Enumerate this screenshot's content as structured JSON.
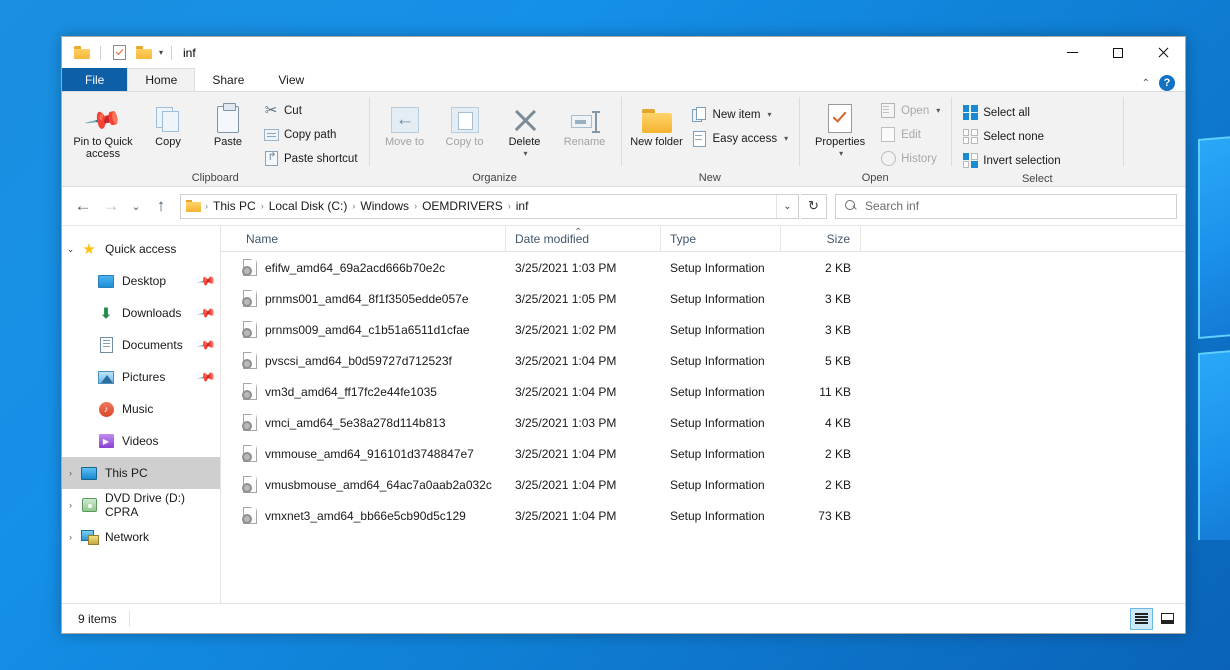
{
  "window": {
    "title": "inf",
    "controls": {
      "minimize": "—",
      "maximize": "□",
      "close": "✕"
    },
    "quick_access_toolbar": [
      {
        "name": "folder-icon",
        "label": "Folder"
      },
      {
        "name": "properties-icon",
        "label": "Properties"
      },
      {
        "name": "new-folder-icon",
        "label": "New folder"
      },
      {
        "name": "customize-caret-icon",
        "label": "▾"
      }
    ]
  },
  "ribbon": {
    "tabs": [
      {
        "label": "File",
        "active": false,
        "kind": "file"
      },
      {
        "label": "Home",
        "active": true,
        "kind": "normal"
      },
      {
        "label": "Share",
        "active": false,
        "kind": "normal"
      },
      {
        "label": "View",
        "active": false,
        "kind": "normal"
      }
    ],
    "collapse_arrow": "⌃",
    "help_label": "?",
    "groups": [
      {
        "label": "Clipboard",
        "big_buttons": [
          {
            "label": "Pin to Quick access",
            "icon": "pin-icon",
            "disabled": false
          },
          {
            "label": "Copy",
            "icon": "copy-icon",
            "disabled": false
          },
          {
            "label": "Paste",
            "icon": "paste-icon",
            "disabled": false
          }
        ],
        "small_buttons": [
          {
            "label": "Cut",
            "icon": "cut-icon",
            "disabled": false
          },
          {
            "label": "Copy path",
            "icon": "copy-path-icon",
            "disabled": false
          },
          {
            "label": "Paste shortcut",
            "icon": "paste-shortcut-icon",
            "disabled": false
          }
        ]
      },
      {
        "label": "Organize",
        "big_buttons": [
          {
            "label": "Move to",
            "icon": "move-to-icon",
            "disabled": true,
            "caret": "▾"
          },
          {
            "label": "Copy to",
            "icon": "copy-to-icon",
            "disabled": true,
            "caret": "▾"
          },
          {
            "label": "Delete",
            "icon": "delete-icon",
            "disabled": false,
            "caret": "▾"
          },
          {
            "label": "Rename",
            "icon": "rename-icon",
            "disabled": true
          }
        ],
        "small_buttons": []
      },
      {
        "label": "New",
        "big_buttons": [
          {
            "label": "New folder",
            "icon": "new-folder-icon",
            "disabled": false
          }
        ],
        "small_buttons": [
          {
            "label": "New item",
            "icon": "new-item-icon",
            "disabled": false,
            "caret": "▾"
          },
          {
            "label": "Easy access",
            "icon": "easy-access-icon",
            "disabled": false,
            "caret": "▾"
          }
        ]
      },
      {
        "label": "Open",
        "big_buttons": [
          {
            "label": "Properties",
            "icon": "properties-icon",
            "disabled": false,
            "caret": "▾"
          }
        ],
        "small_buttons": [
          {
            "label": "Open",
            "icon": "open-icon",
            "disabled": true,
            "caret": "▾"
          },
          {
            "label": "Edit",
            "icon": "edit-icon",
            "disabled": true
          },
          {
            "label": "History",
            "icon": "history-icon",
            "disabled": true
          }
        ]
      },
      {
        "label": "Select",
        "big_buttons": [],
        "small_buttons": [
          {
            "label": "Select all",
            "icon": "select-all-icon",
            "disabled": false
          },
          {
            "label": "Select none",
            "icon": "select-none-icon",
            "disabled": false
          },
          {
            "label": "Invert selection",
            "icon": "invert-selection-icon",
            "disabled": false
          }
        ]
      }
    ]
  },
  "navigation": {
    "back": "←",
    "forward": "→",
    "recent": "⌄",
    "up": "↑",
    "breadcrumbs": [
      "This PC",
      "Local Disk (C:)",
      "Windows",
      "OEMDRIVERS",
      "inf"
    ],
    "separator": "›",
    "dropdown": "⌄",
    "refresh": "↻"
  },
  "search": {
    "placeholder": "Search inf",
    "icon": "search-icon"
  },
  "sidebar": {
    "items": [
      {
        "label": "Quick access",
        "icon": "star-icon",
        "chevron": "⌄",
        "expanded": true,
        "level": 0,
        "pinned": false,
        "selected": false
      },
      {
        "label": "Desktop",
        "icon": "desktop-icon",
        "chevron": "",
        "level": 1,
        "pinned": true,
        "selected": false
      },
      {
        "label": "Downloads",
        "icon": "downloads-icon",
        "chevron": "",
        "level": 1,
        "pinned": true,
        "selected": false
      },
      {
        "label": "Documents",
        "icon": "documents-icon",
        "chevron": "",
        "level": 1,
        "pinned": true,
        "selected": false
      },
      {
        "label": "Pictures",
        "icon": "pictures-icon",
        "chevron": "",
        "level": 1,
        "pinned": true,
        "selected": false
      },
      {
        "label": "Music",
        "icon": "music-icon",
        "chevron": "",
        "level": 1,
        "pinned": false,
        "selected": false
      },
      {
        "label": "Videos",
        "icon": "videos-icon",
        "chevron": "",
        "level": 1,
        "pinned": false,
        "selected": false
      },
      {
        "label": "This PC",
        "icon": "this-pc-icon",
        "chevron": "›",
        "level": 0,
        "pinned": false,
        "selected": true
      },
      {
        "label": "DVD Drive (D:) CPRA",
        "icon": "dvd-drive-icon",
        "chevron": "›",
        "level": 0,
        "pinned": false,
        "selected": false
      },
      {
        "label": "Network",
        "icon": "network-icon",
        "chevron": "›",
        "level": 0,
        "pinned": false,
        "selected": false
      }
    ]
  },
  "filelist": {
    "columns": [
      "Name",
      "Date modified",
      "Type",
      "Size"
    ],
    "sort_column": "Name",
    "sort_indicator": "⌃",
    "rows": [
      {
        "name": "efifw_amd64_69a2acd666b70e2c",
        "date": "3/25/2021 1:03 PM",
        "type": "Setup Information",
        "size": "2 KB"
      },
      {
        "name": "prnms001_amd64_8f1f3505edde057e",
        "date": "3/25/2021 1:05 PM",
        "type": "Setup Information",
        "size": "3 KB"
      },
      {
        "name": "prnms009_amd64_c1b51a6511d1cfae",
        "date": "3/25/2021 1:02 PM",
        "type": "Setup Information",
        "size": "3 KB"
      },
      {
        "name": "pvscsi_amd64_b0d59727d712523f",
        "date": "3/25/2021 1:04 PM",
        "type": "Setup Information",
        "size": "5 KB"
      },
      {
        "name": "vm3d_amd64_ff17fc2e44fe1035",
        "date": "3/25/2021 1:04 PM",
        "type": "Setup Information",
        "size": "11 KB"
      },
      {
        "name": "vmci_amd64_5e38a278d114b813",
        "date": "3/25/2021 1:03 PM",
        "type": "Setup Information",
        "size": "4 KB"
      },
      {
        "name": "vmmouse_amd64_916101d3748847e7",
        "date": "3/25/2021 1:04 PM",
        "type": "Setup Information",
        "size": "2 KB"
      },
      {
        "name": "vmusbmouse_amd64_64ac7a0aab2a032c",
        "date": "3/25/2021 1:04 PM",
        "type": "Setup Information",
        "size": "2 KB"
      },
      {
        "name": "vmxnet3_amd64_bb66e5cb90d5c129",
        "date": "3/25/2021 1:04 PM",
        "type": "Setup Information",
        "size": "73 KB"
      }
    ]
  },
  "statusbar": {
    "item_count": "9 items",
    "views": [
      {
        "name": "details-view-button",
        "active": true
      },
      {
        "name": "large-icons-view-button",
        "active": false
      }
    ]
  },
  "colors": {
    "accent": "#0d5fa8",
    "desktop": "#1590e8",
    "selection": "#cfcfcf",
    "tab_active": "#f2f2f2"
  }
}
